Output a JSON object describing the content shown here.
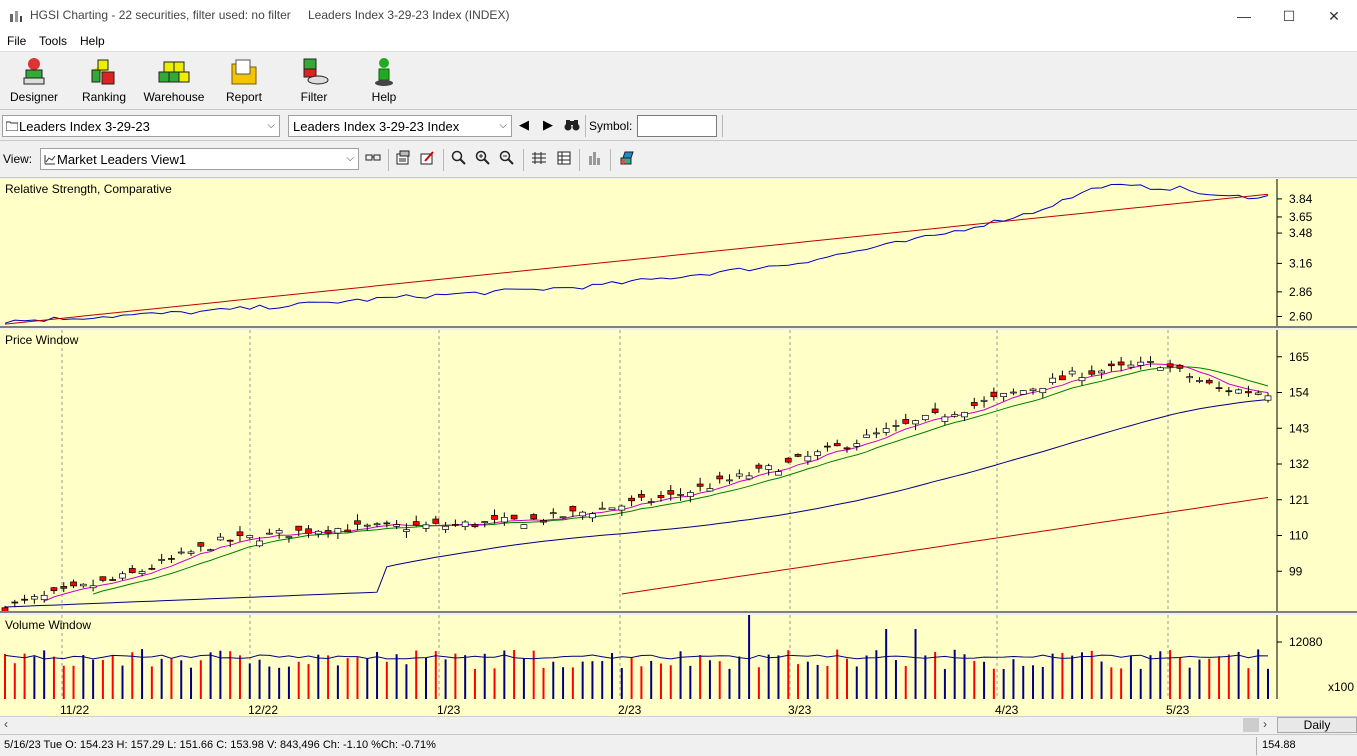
{
  "window": {
    "title": "HGSI Charting - 22 securities, filter used: no filter",
    "subtitle": "Leaders Index 3-29-23 Index (INDEX)",
    "minimize": "—",
    "maximize": "☐",
    "close": "✕"
  },
  "menu": [
    "File",
    "Tools",
    "Help"
  ],
  "toolbar": [
    {
      "label": "Designer",
      "icon": "designer-icon"
    },
    {
      "label": "Ranking",
      "icon": "ranking-icon"
    },
    {
      "label": "Warehouse",
      "icon": "warehouse-icon"
    },
    {
      "label": "Report",
      "icon": "report-icon"
    },
    {
      "label": "Filter",
      "icon": "filter-icon"
    },
    {
      "label": "Help",
      "icon": "help-icon"
    }
  ],
  "selectors": {
    "list": "Leaders Index 3-29-23",
    "security": "Leaders Index 3-29-23 Index",
    "symbol_label": "Symbol:",
    "symbol_value": "",
    "view_label": "View:",
    "view": "Market Leaders View1"
  },
  "panes": {
    "rs": {
      "title": "Relative Strength, Comparative",
      "ticks": [
        "3.84",
        "3.65",
        "3.48",
        "3.16",
        "2.86",
        "2.60"
      ]
    },
    "price": {
      "title": "Price Window",
      "ticks": [
        "165",
        "154",
        "143",
        "132",
        "121",
        "110",
        "99"
      ]
    },
    "volume": {
      "title": "Volume Window",
      "ticks": [
        "12080"
      ],
      "multiplier": "x100"
    }
  },
  "x_axis": [
    "11/22",
    "12/22",
    "1/23",
    "2/23",
    "3/23",
    "4/23",
    "5/23"
  ],
  "periodicity": "Daily",
  "status": {
    "quote": "5/16/23 Tue O: 154.23 H: 157.29 L: 151.66 C: 153.98 V: 843,496 Ch: -1.10 %Ch: -0.71%",
    "last": "154.88"
  },
  "colors": {
    "pane_bg": "#ffffc8",
    "up_candle": "#ffffff",
    "down_candle": "#ff0000",
    "ma_short": "#cc00cc",
    "ma_mid": "#008000",
    "ma_long": "#000080",
    "ma_longest": "#c00000",
    "rs_line": "#0000c0"
  }
}
